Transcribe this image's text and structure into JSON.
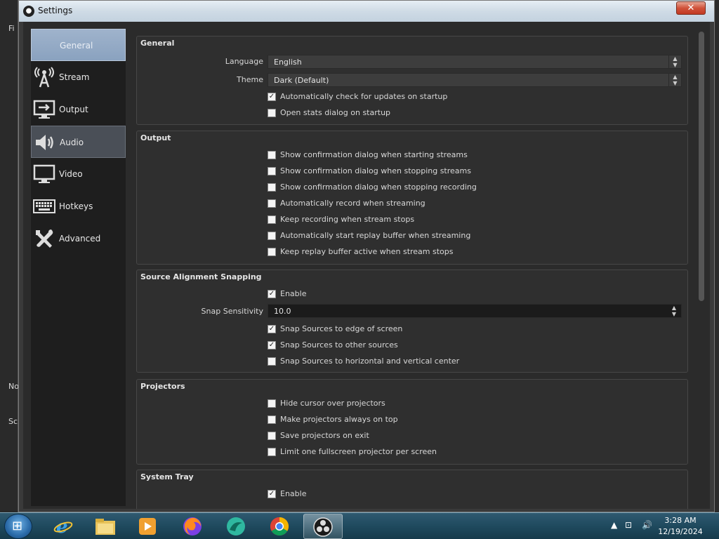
{
  "window": {
    "title": "Settings",
    "close_label": "✕"
  },
  "background_window": {
    "left_labels": [
      "Fi",
      "No",
      "Sc"
    ]
  },
  "nav": {
    "items": [
      {
        "label": "General",
        "icon": "gear-icon",
        "state": "selected"
      },
      {
        "label": "Stream",
        "icon": "antenna-icon",
        "state": "normal"
      },
      {
        "label": "Output",
        "icon": "output-monitor-icon",
        "state": "normal"
      },
      {
        "label": "Audio",
        "icon": "speaker-icon",
        "state": "hovered"
      },
      {
        "label": "Video",
        "icon": "monitor-icon",
        "state": "normal"
      },
      {
        "label": "Hotkeys",
        "icon": "keyboard-icon",
        "state": "normal"
      },
      {
        "label": "Advanced",
        "icon": "tools-icon",
        "state": "normal"
      }
    ]
  },
  "general": {
    "title": "General",
    "language_label": "Language",
    "language_value": "English",
    "theme_label": "Theme",
    "theme_value": "Dark (Default)",
    "check_updates": {
      "label": "Automatically check for updates on startup",
      "checked": true
    },
    "open_stats": {
      "label": "Open stats dialog on startup",
      "checked": false
    }
  },
  "output": {
    "title": "Output",
    "options": [
      {
        "label": "Show confirmation dialog when starting streams",
        "checked": false
      },
      {
        "label": "Show confirmation dialog when stopping streams",
        "checked": false
      },
      {
        "label": "Show confirmation dialog when stopping recording",
        "checked": false
      },
      {
        "label": "Automatically record when streaming",
        "checked": false
      },
      {
        "label": "Keep recording when stream stops",
        "checked": false
      },
      {
        "label": "Automatically start replay buffer when streaming",
        "checked": false
      },
      {
        "label": "Keep replay buffer active when stream stops",
        "checked": false
      }
    ]
  },
  "snapping": {
    "title": "Source Alignment Snapping",
    "enable": {
      "label": "Enable",
      "checked": true
    },
    "sensitivity_label": "Snap Sensitivity",
    "sensitivity_value": "10.0",
    "options": [
      {
        "label": "Snap Sources to edge of screen",
        "checked": true
      },
      {
        "label": "Snap Sources to other sources",
        "checked": true
      },
      {
        "label": "Snap Sources to horizontal and vertical center",
        "checked": false
      }
    ]
  },
  "projectors": {
    "title": "Projectors",
    "options": [
      {
        "label": "Hide cursor over projectors",
        "checked": false
      },
      {
        "label": "Make projectors always on top",
        "checked": false
      },
      {
        "label": "Save projectors on exit",
        "checked": false
      },
      {
        "label": "Limit one fullscreen projector per screen",
        "checked": false
      }
    ]
  },
  "system_tray": {
    "title": "System Tray",
    "enable": {
      "label": "Enable",
      "checked": true
    }
  },
  "taskbar": {
    "apps": [
      "internet-explorer-icon",
      "file-explorer-icon",
      "media-player-icon",
      "firefox-icon",
      "app-icon",
      "chrome-icon",
      "obs-icon"
    ],
    "time": "3:28 AM",
    "date": "12/19/2024"
  },
  "colors": {
    "nav_selected": "#8aa2bf",
    "dialog_bg": "#2b2b2b",
    "taskbar": "#1f4a5e"
  }
}
